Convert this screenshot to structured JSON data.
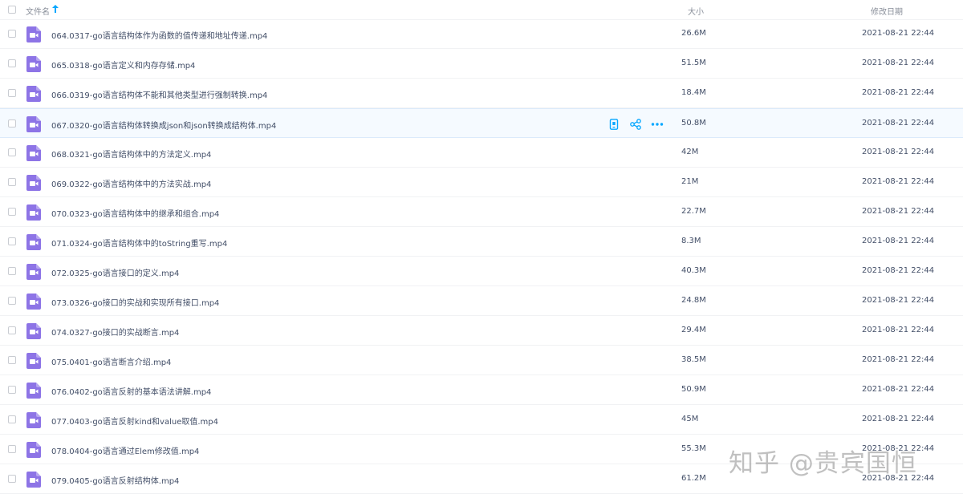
{
  "header": {
    "name_label": "文件名",
    "sort_icon": "arrow-up-icon",
    "size_label": "大小",
    "date_label": "修改日期"
  },
  "row_actions": {
    "icons": [
      "phone-icon",
      "share-icon",
      "more-icon"
    ],
    "accent_color": "#06a7ff"
  },
  "file_icon": {
    "name": "video-file-icon",
    "color": "#8d74e6"
  },
  "files": [
    {
      "name": "064.0317-go语言结构体作为函数的值传递和地址传递.mp4",
      "size": "26.6M",
      "date": "2021-08-21 22:44"
    },
    {
      "name": "065.0318-go语言定义和内存存储.mp4",
      "size": "51.5M",
      "date": "2021-08-21 22:44"
    },
    {
      "name": "066.0319-go语言结构体不能和其他类型进行强制转换.mp4",
      "size": "18.4M",
      "date": "2021-08-21 22:44"
    },
    {
      "name": "067.0320-go语言结构体转换成json和json转换成结构体.mp4",
      "size": "50.8M",
      "date": "2021-08-21 22:44"
    },
    {
      "name": "068.0321-go语言结构体中的方法定义.mp4",
      "size": "42M",
      "date": "2021-08-21 22:44"
    },
    {
      "name": "069.0322-go语言结构体中的方法实战.mp4",
      "size": "21M",
      "date": "2021-08-21 22:44"
    },
    {
      "name": "070.0323-go语言结构体中的继承和组合.mp4",
      "size": "22.7M",
      "date": "2021-08-21 22:44"
    },
    {
      "name": "071.0324-go语言结构体中的toString重写.mp4",
      "size": "8.3M",
      "date": "2021-08-21 22:44"
    },
    {
      "name": "072.0325-go语言接口的定义.mp4",
      "size": "40.3M",
      "date": "2021-08-21 22:44"
    },
    {
      "name": "073.0326-go接口的实战和实现所有接口.mp4",
      "size": "24.8M",
      "date": "2021-08-21 22:44"
    },
    {
      "name": "074.0327-go接口的实战断言.mp4",
      "size": "29.4M",
      "date": "2021-08-21 22:44"
    },
    {
      "name": "075.0401-go语言断言介绍.mp4",
      "size": "38.5M",
      "date": "2021-08-21 22:44"
    },
    {
      "name": "076.0402-go语言反射的基本语法讲解.mp4",
      "size": "50.9M",
      "date": "2021-08-21 22:44"
    },
    {
      "name": "077.0403-go语言反射kind和value取值.mp4",
      "size": "45M",
      "date": "2021-08-21 22:44"
    },
    {
      "name": "078.0404-go语言通过Elem修改值.mp4",
      "size": "55.3M",
      "date": "2021-08-21 22:44"
    },
    {
      "name": "079.0405-go语言反射结构体.mp4",
      "size": "61.2M",
      "date": "2021-08-21 22:44"
    }
  ],
  "watermark": "知乎 @贵宾国恒"
}
